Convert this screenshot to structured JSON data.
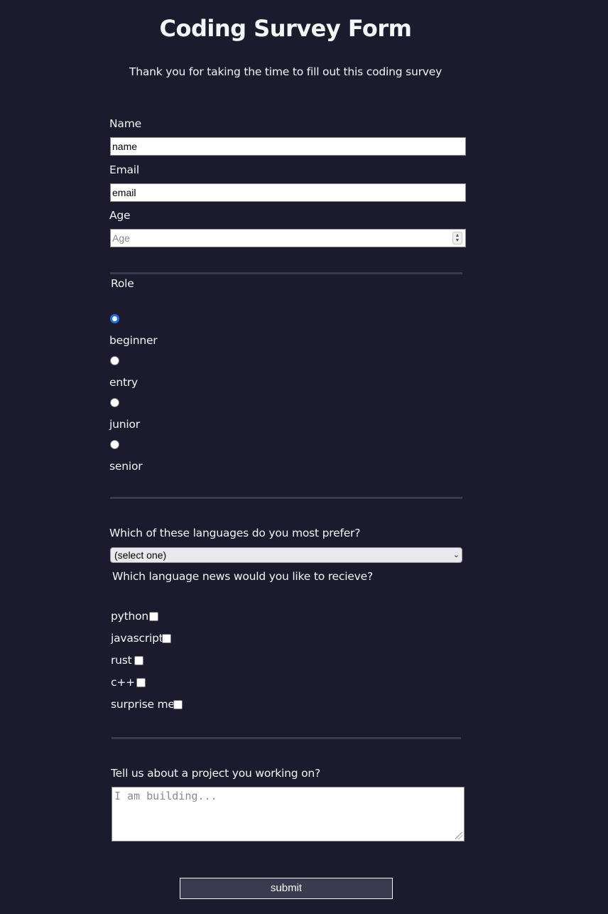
{
  "header": {
    "title": "Coding Survey Form",
    "description": "Thank you for taking the time to fill out this coding survey"
  },
  "fields": {
    "name_label": "Name",
    "name_value": "name",
    "email_label": "Email",
    "email_value": "email",
    "age_label": "Age",
    "age_placeholder": "Age"
  },
  "role": {
    "legend": "Role",
    "selected": "beginner",
    "options": [
      "beginner",
      "entry",
      "junior",
      "senior"
    ]
  },
  "languages": {
    "prefer_label": "Which of these languages do you most prefer?",
    "prefer_selected": "(select one)",
    "news_label": "Which language news would you like to recieve?",
    "news_options": [
      "python",
      "javascript",
      "rust",
      "c++",
      "surprise me"
    ]
  },
  "project": {
    "label": "Tell us about a project you working on?",
    "placeholder": "I am building..."
  },
  "submit_label": "submit",
  "colors": {
    "background": "#1b1b2d",
    "text": "#f5f6f7",
    "divider": "#3b3b4f",
    "radio_accent": "#1f6de8",
    "submit_bg": "#3b3b4f"
  }
}
